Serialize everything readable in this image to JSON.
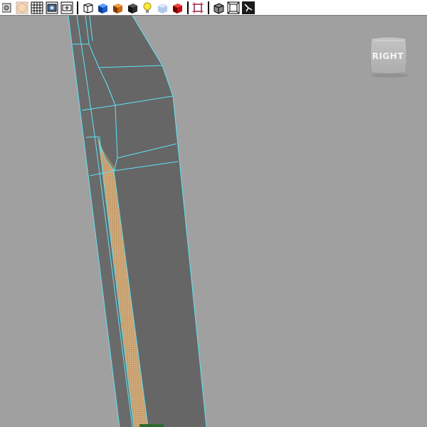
{
  "toolbar": {
    "buttons": [
      {
        "id": "select-camera",
        "icon": "camera-select-icon"
      },
      {
        "id": "isolate",
        "icon": "sphere-icon"
      },
      {
        "id": "grid",
        "icon": "grid-icon"
      },
      {
        "id": "film-gate",
        "icon": "film-gate-icon"
      },
      {
        "id": "resolution-gate",
        "icon": "texture-gate-icon"
      },
      {
        "id": "wireframe",
        "icon": "wireframe-cube-icon"
      },
      {
        "id": "smooth-shade",
        "icon": "smooth-shade-cube-icon"
      },
      {
        "id": "textured",
        "icon": "textured-cube-icon"
      },
      {
        "id": "shadows",
        "icon": "dark-cube-icon"
      },
      {
        "id": "lights",
        "icon": "lightbulb-icon"
      },
      {
        "id": "xray",
        "icon": "xray-cube-icon"
      },
      {
        "id": "xray-joints",
        "icon": "red-cube-icon"
      },
      {
        "id": "isolate-select",
        "icon": "isolate-select-icon"
      },
      {
        "id": "wireframe-on-shaded",
        "icon": "wireframe-shaded-icon"
      },
      {
        "id": "frame-all",
        "icon": "frame-all-icon"
      },
      {
        "id": "hud",
        "icon": "hud-icon"
      }
    ]
  },
  "view_cube": {
    "label": "RIGHT"
  },
  "colors": {
    "viewport_bg": "#a0a0a0",
    "mesh_face": "#666666",
    "mesh_edge": "#5ee3f5",
    "selected_face": "#c8a070"
  }
}
